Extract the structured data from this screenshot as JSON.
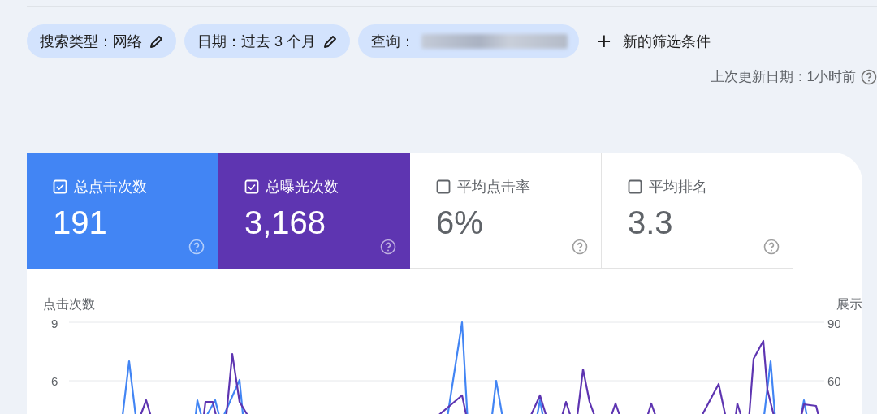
{
  "filters": [
    {
      "label": "搜索类型：网络",
      "editable": true,
      "redacted": false
    },
    {
      "label": "日期：过去 3 个月",
      "editable": true,
      "redacted": false
    },
    {
      "label": "查询：",
      "editable": false,
      "redacted": true
    }
  ],
  "new_filter": {
    "icon": "+",
    "label": "新的筛选条件"
  },
  "last_updated": "上次更新日期：1小时前",
  "metrics": [
    {
      "label": "总点击次数",
      "value": "191",
      "selected": true,
      "color": "#4285f4"
    },
    {
      "label": "总曝光次数",
      "value": "3,168",
      "selected": true,
      "color": "#5e35b1"
    },
    {
      "label": "平均点击率",
      "value": "6%",
      "selected": false
    },
    {
      "label": "平均排名",
      "value": "3.3",
      "selected": false
    }
  ],
  "chart": {
    "left_axis_title": "点击次数",
    "right_axis_title": "展示",
    "left_ticks": [
      "9",
      "6"
    ],
    "right_ticks": [
      "90",
      "60"
    ]
  }
}
